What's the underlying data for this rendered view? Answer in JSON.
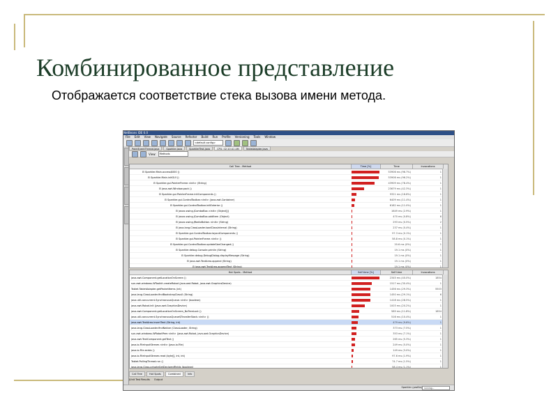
{
  "slide": {
    "title": "Комбинированное представление",
    "subtitle": "Отображается соответствие стека вызова имени метода."
  },
  "ide": {
    "window_title": "NetBeans IDE 6.0",
    "menu": [
      "File",
      "Edit",
      "View",
      "Navigate",
      "Source",
      "Refactor",
      "Build",
      "Run",
      "Profile",
      "Versioning",
      "Tools",
      "Window",
      "Help"
    ],
    "config": "<default config>",
    "tabs": [
      "PaintEventThread.java",
      "Sparkler.java",
      "SparklerTest.java",
      "CPU: 02:10:41 AM",
      "TableAdapter.java"
    ],
    "view_label": "View:",
    "view_value": "Methods",
    "bottom_tabs": [
      "Call Tree",
      "Hot Spots",
      "Combined",
      "Info"
    ],
    "output_tabs": [
      "JUnit Test Results",
      "Output"
    ],
    "status_text": "Sparkler (profile)",
    "status_progress": "running..."
  },
  "call_tree": {
    "columns": [
      "Call Tree - Method",
      "Time [%]",
      "Time",
      "Invocations"
    ],
    "rows": [
      {
        "depth": 0,
        "name": "Sparkler.Main.access$000 ()",
        "percent": 98,
        "time": "53906 ms (96.7%)",
        "inv": "1"
      },
      {
        "depth": 1,
        "name": "Sparkler.Main.initGUI ()",
        "percent": 96,
        "time": "53906 ms (96.2%)",
        "inv": "1"
      },
      {
        "depth": 2,
        "name": "Sparkler.gui.PainterFrame.<init> (String)",
        "percent": 80,
        "time": "43909 ms (78.4%)",
        "inv": "1"
      },
      {
        "depth": 3,
        "name": "java.awt.Window.pack ()",
        "percent": 44,
        "time": "23679 ms (42.3%)",
        "inv": "1"
      },
      {
        "depth": 3,
        "name": "Sparkler.gui.PainterFrame.initComponents ()",
        "percent": 16,
        "time": "9321 ms (16.6%)",
        "inv": "1"
      },
      {
        "depth": 4,
        "name": "Sparkler.gui.ControlToolbar.<init> (java.awt.Container)",
        "percent": 12,
        "time": "6409 ms (11.4%)",
        "inv": "1"
      },
      {
        "depth": 5,
        "name": "Sparkler.gui.ControlToolbar.initExterior ()",
        "percent": 11,
        "time": "6182 ms (11.0%)",
        "inv": "1"
      },
      {
        "depth": 6,
        "name": "javax.swing.JComboBox.<init> (Object[])",
        "percent": 2,
        "time": "1649 ms (2.9%)",
        "inv": "1"
      },
      {
        "depth": 6,
        "name": "javax.swing.JComboBox.addItem (Object)",
        "percent": 1,
        "time": "470 ms (0.8%)",
        "inv": "6"
      },
      {
        "depth": 6,
        "name": "javax.swing.JRadioButton.<init> (String)",
        "percent": 1,
        "time": "293 ms (0.5%)",
        "inv": "2"
      },
      {
        "depth": 6,
        "name": "java.lang.ClassLoader.loadClassInternal (String)",
        "percent": 0.4,
        "time": "237 ms (0.4%)",
        "inv": "1"
      },
      {
        "depth": 6,
        "name": "Sparkler.gui.ControlToolbar.layoutComponents ()",
        "percent": 0.2,
        "time": "97.3 ms (0.1%)",
        "inv": "1"
      },
      {
        "depth": 6,
        "name": "Sparkler.gui.PainterFrame.<init> ()",
        "percent": 0.1,
        "time": "58.8 ms (0.1%)",
        "inv": "1"
      },
      {
        "depth": 5,
        "name": "Sparkler.gui.ControlToolbar.updateSizeChanged ()",
        "percent": 0.1,
        "time": "20.6 ms (0%)",
        "inv": "1"
      },
      {
        "depth": 6,
        "name": "Sparkler.debug.Console.println (String)",
        "percent": 0.05,
        "time": "19.1 ms (0%)",
        "inv": "1"
      },
      {
        "depth": 7,
        "name": "Sparkler.debug.DebugDialog.displayMessage (String)",
        "percent": 0.05,
        "time": "19.1 ms (0%)",
        "inv": "1"
      },
      {
        "depth": 8,
        "name": "java.awt.TextArea.append (String)",
        "percent": 0.05,
        "time": "19.1 ms (0%)",
        "inv": "1"
      },
      {
        "depth": 9,
        "name": "java.awt.TextArea.appendText (String)",
        "percent": 0.05,
        "time": "19.1 ms (0%)",
        "inv": "1"
      },
      {
        "depth": 10,
        "name": "java.awt.TextComponent.getText ()",
        "percent": 0.02,
        "time": "13.6 ms (0%)",
        "inv": "1"
      },
      {
        "depth": 10,
        "name": "java.awt.TextArea.insertText (String, int)",
        "percent": 0.01,
        "time": "5.44 ms (0%)",
        "inv": "1",
        "selected": true
      }
    ]
  },
  "hot_spots": {
    "columns": [
      "Hot Spots - Method",
      "Self time [%]",
      "Self time",
      "Invocations"
    ],
    "rows": [
      {
        "name": "java.awt.Component.getLocationOnScreen ()",
        "percent": 42,
        "time": "2345 ms (40.0%)",
        "inv": "1854"
      },
      {
        "name": "sun.awt.windows.WToolkit.createRobot (java.awt.Robot, java.awt.GraphicsDevice)",
        "percent": 30,
        "time": "1517 ms (30.4%)",
        "inv": "1"
      },
      {
        "name": "Tablet.TabletAdapter.getPacketItems (int)",
        "percent": 28,
        "time": "1456 ms (29.3%)",
        "inv": "5503"
      },
      {
        "name": "java.lang.ClassLoader.findBootstrapClass0 (String)",
        "percent": 28,
        "time": "1450 ms (29.1%)",
        "inv": "6"
      },
      {
        "name": "java.util.concurrent.SynchronousQueue.<init> (boolean)",
        "percent": 28,
        "time": "1418 ms (28.5%)",
        "inv": "1"
      },
      {
        "name": "java.awt.Robot.init (java.awt.GraphicsDevice)",
        "percent": 20,
        "time": "1003 ms (20.2%)",
        "inv": "1"
      },
      {
        "name": "java.awt.Component.getLocationOnScreen_NoTreeLock ()",
        "percent": 12,
        "time": "589 ms (11.8%)",
        "inv": "1854"
      },
      {
        "name": "java.util.concurrent.SynchronousQueue$TransferStack.<init> ()",
        "percent": 10,
        "time": "516 ms (10.4%)",
        "inv": "1"
      },
      {
        "name": "java.awt.TextArea.insertText (String, int)",
        "percent": 9,
        "time": "479 ms (9.6%)",
        "inv": "1",
        "selected": true
      },
      {
        "name": "java.lang.ClassLoader.findNative (ClassLoader, String)",
        "percent": 7,
        "time": "373 ms (7.5%)",
        "inv": "1"
      },
      {
        "name": "sun.awt.windows.WRobotPeer.<init> (java.awt.Robot, java.awt.GraphicsDevice)",
        "percent": 7,
        "time": "353 ms (7.1%)",
        "inv": "1"
      },
      {
        "name": "java.awt.TextComponent.getText ()",
        "percent": 5,
        "time": "265 ms (5.3%)",
        "inv": "1"
      },
      {
        "name": "java.io.FileInputStream.<init> (java.io.File)",
        "percent": 5,
        "time": "249 ms (5.0%)",
        "inv": "1"
      },
      {
        "name": "java.io.File.exists ()",
        "percent": 3,
        "time": "149 ms (3.0%)",
        "inv": "1"
      },
      {
        "name": "java.io.FileInputStream.read (byte[], int, int)",
        "percent": 2,
        "time": "97.6 ms (1.9%)",
        "inv": "1"
      },
      {
        "name": "Tablet.PollingThread.run ()",
        "percent": 2,
        "time": "74.7 ms (1.5%)",
        "inv": "1"
      },
      {
        "name": "java.lang.Class.privateGetDeclaredFields (boolean)",
        "percent": 1,
        "time": "58.4 ms (1.1%)",
        "inv": "1"
      },
      {
        "name": "java.util.concurrent.SynchronousQueue.take ()",
        "percent": 1,
        "time": "57.1 ms (1.1%)",
        "inv": "1"
      },
      {
        "name": "sun.awt.Win32GraphicsConfig.getBounds (int)",
        "percent": 1,
        "time": "52.1 ms (1.0%)",
        "inv": "1"
      }
    ]
  }
}
